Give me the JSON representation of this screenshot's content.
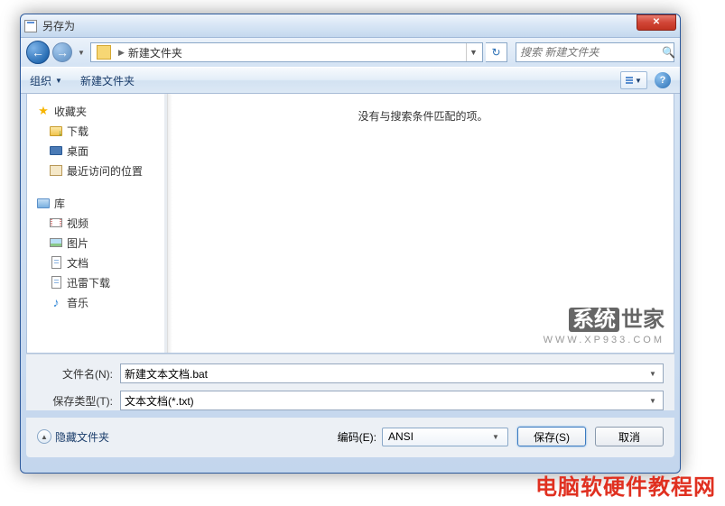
{
  "window": {
    "title": "另存为"
  },
  "nav": {
    "path": "新建文件夹",
    "search_placeholder": "搜索 新建文件夹"
  },
  "toolbar": {
    "organize": "组织",
    "new_folder": "新建文件夹"
  },
  "sidebar": {
    "favorites": "收藏夹",
    "downloads": "下载",
    "desktop": "桌面",
    "recent": "最近访问的位置",
    "libraries": "库",
    "videos": "视频",
    "pictures": "图片",
    "documents": "文档",
    "xunlei": "迅雷下载",
    "music": "音乐"
  },
  "content": {
    "empty_message": "没有与搜索条件匹配的项。"
  },
  "watermark": {
    "brand_box": "系统",
    "brand_text": "世家",
    "url": "WWW.XP933.COM"
  },
  "form": {
    "filename_label": "文件名(N):",
    "filename_value": "新建文本文档.bat",
    "filetype_label": "保存类型(T):",
    "filetype_value": "文本文档(*.txt)"
  },
  "footer": {
    "hidden_folders": "隐藏文件夹",
    "encoding_label": "编码(E):",
    "encoding_value": "ANSI",
    "save": "保存(S)",
    "cancel": "取消"
  },
  "overlay": "电脑软硬件教程网"
}
